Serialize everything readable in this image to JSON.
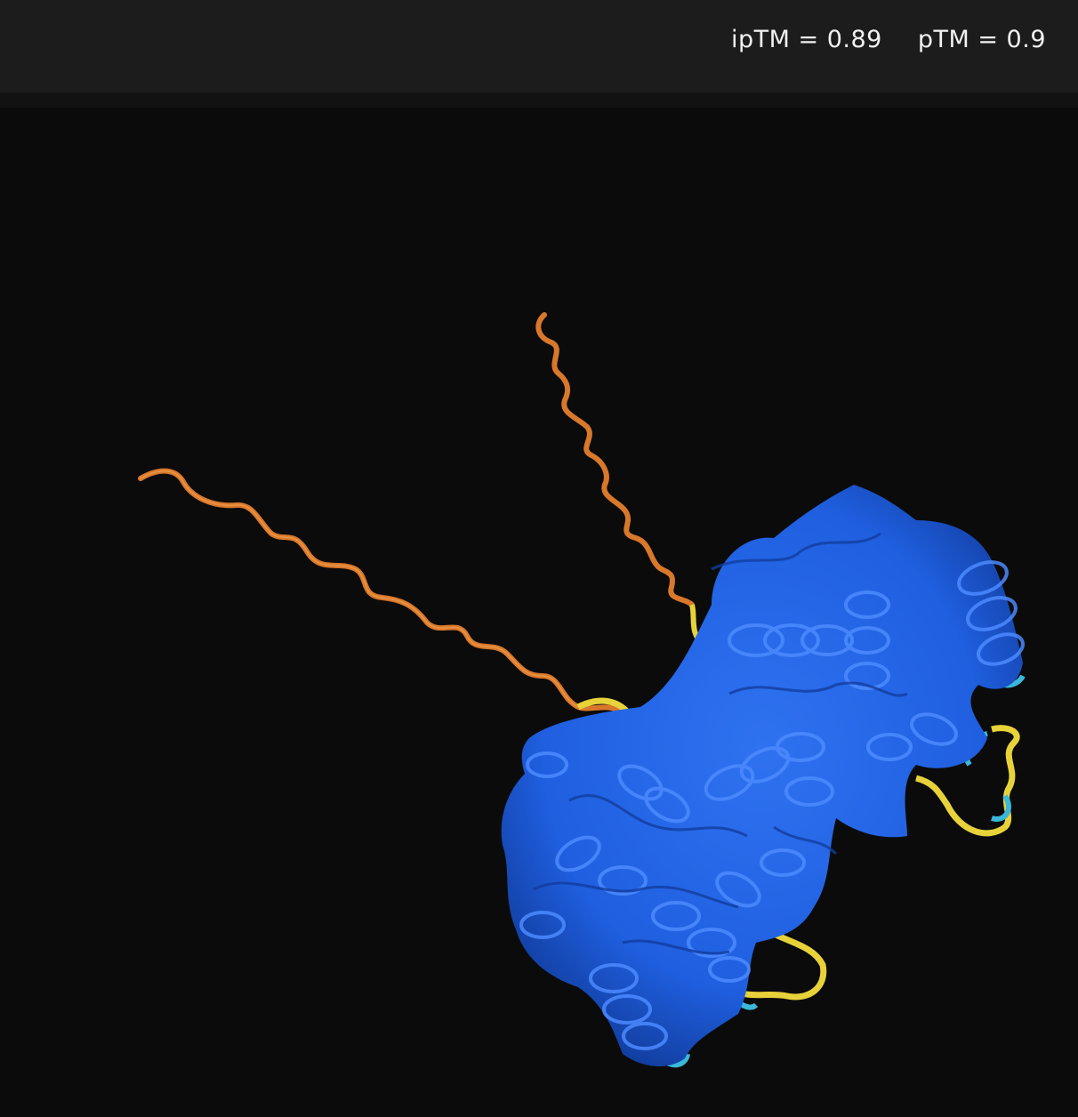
{
  "header": {
    "iptm_label": "ipTM = 0.89",
    "ptm_label": "pTM = 0.9"
  },
  "viewer": {
    "structure": "protein-complex-cartoon",
    "colors": {
      "very_high_confidence": "#1f5fe0",
      "confident": "#3bb8d8",
      "low_confidence": "#e8d23a",
      "very_low_confidence": "#e07b2a",
      "background": "#0b0b0c"
    }
  }
}
